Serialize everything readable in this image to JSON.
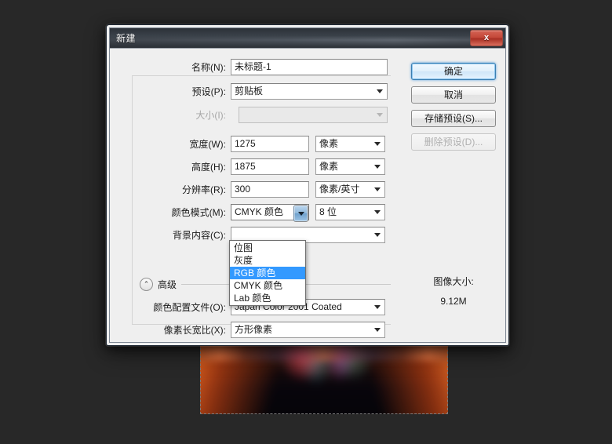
{
  "window": {
    "title": "新建",
    "close_icon": "close-icon",
    "close_label": "x"
  },
  "form": {
    "name": {
      "label": "名称(N):",
      "value": "未标题-1"
    },
    "preset": {
      "label": "预设(P):",
      "value": "剪贴板"
    },
    "size": {
      "label": "大小(I):",
      "value": "",
      "disabled": true
    },
    "width": {
      "label": "宽度(W):",
      "value": "1275",
      "unit": "像素"
    },
    "height": {
      "label": "高度(H):",
      "value": "1875",
      "unit": "像素"
    },
    "resolution": {
      "label": "分辨率(R):",
      "value": "300",
      "unit": "像素/英寸"
    },
    "color_mode": {
      "label": "颜色模式(M):",
      "value": "CMYK 颜色",
      "depth": "8 位"
    },
    "background_contents": {
      "label": "背景内容(C):",
      "value": ""
    }
  },
  "advanced": {
    "label": "高级",
    "toggle_icon": "chevron-up-icon",
    "toggle_glyph": "⌃",
    "color_profile": {
      "label": "颜色配置文件(O):",
      "value": "Japan Color 2001 Coated"
    },
    "pixel_aspect_ratio": {
      "label": "像素长宽比(X):",
      "value": "方形像素"
    }
  },
  "dropdown": {
    "open": true,
    "items": [
      {
        "label": "位图",
        "selected": false
      },
      {
        "label": "灰度",
        "selected": false
      },
      {
        "label": "RGB 颜色",
        "selected": true
      },
      {
        "label": "CMYK 颜色",
        "selected": false
      },
      {
        "label": "Lab 颜色",
        "selected": false
      }
    ],
    "highlight_color": "#3399ff"
  },
  "buttons": {
    "ok": "确定",
    "cancel": "取消",
    "save_preset": "存储预设(S)...",
    "delete_preset": "删除预设(D)..."
  },
  "image_size": {
    "label": "图像大小:",
    "value": "9.12M"
  },
  "colors": {
    "desktop": "#282828",
    "dialog_bg": "#efefef",
    "titlebar": "#3a4149",
    "close_button": "#c4493a",
    "default_button_border": "#3c7fb1"
  }
}
